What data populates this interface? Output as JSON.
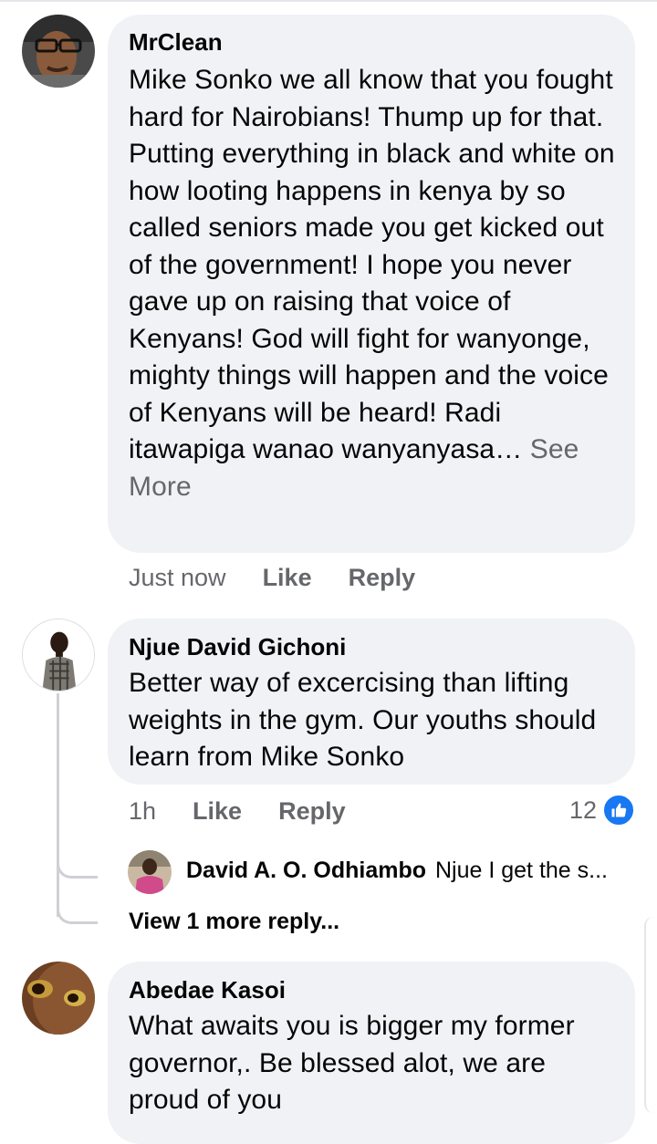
{
  "comments": [
    {
      "author": "MrClean",
      "text": "Mike Sonko we all know that you fought hard for Nairobians! Thump up for that. Putting everything in black and white on how looting happens in kenya by so called seniors made  you get kicked out of the government! I hope you never gave up on raising that voice of Kenyans! God will fight for wanyonge, mighty things will happen and the voice of Kenyans will be heard! Radi itawapiga wanao wanyanyasa…",
      "see_more": "See More",
      "time": "Just now",
      "like": "Like",
      "reply": "Reply"
    },
    {
      "author": "Njue David Gichoni",
      "text": "Better way of excercising than lifting weights in the gym. Our youths should learn from Mike Sonko",
      "time": "1h",
      "like": "Like",
      "reply": "Reply",
      "reaction_count": "12",
      "reply_preview": {
        "author": "David A. O. Odhiambo",
        "text": "Njue I get the s..."
      },
      "view_more_replies": "View 1 more reply..."
    },
    {
      "author": "Abedae Kasoi",
      "text": "What awaits you is bigger my former governor,. Be blessed alot, we are proud of you"
    }
  ],
  "colors": {
    "bubble": "#f0f2f5",
    "meta": "#65676b",
    "like_blue": "#1877f2"
  }
}
